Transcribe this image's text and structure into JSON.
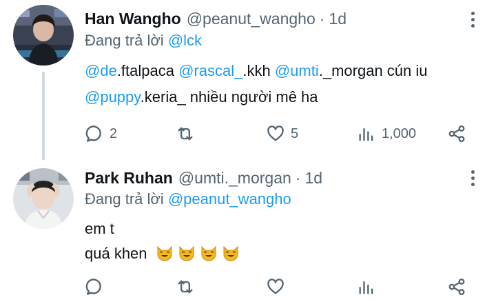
{
  "tweets": [
    {
      "display_name": "Han Wangho",
      "handle": "@peanut_wangho",
      "separator": "·",
      "time": "1d",
      "reply_prefix": "Đang trả lời",
      "reply_handle": "@lck",
      "line1": [
        {
          "text": "@de",
          "mention": true
        },
        {
          "text": ".ftalpaca ",
          "mention": false
        },
        {
          "text": "@rascal_",
          "mention": true
        },
        {
          "text": ".kkh ",
          "mention": false
        },
        {
          "text": "@umti",
          "mention": true
        },
        {
          "text": "._morgan cún iu",
          "mention": false
        }
      ],
      "line2": [
        {
          "text": "@puppy",
          "mention": true
        },
        {
          "text": ".keria_ nhiều người mê ha",
          "mention": false
        }
      ],
      "replies": "2",
      "retweets": "",
      "likes": "5",
      "views": "1,000"
    },
    {
      "display_name": "Park Ruhan",
      "handle": "@umti._morgan",
      "separator": "·",
      "time": "1d",
      "reply_prefix": "Đang trả lời",
      "reply_handle": "@peanut_wangho",
      "line1": [
        {
          "text": "em t",
          "mention": false
        }
      ],
      "line2": [
        {
          "text": "quá khen",
          "mention": false
        }
      ],
      "emoji": [
        "smiling-cat-emoji",
        "smiling-cat-emoji",
        "smiling-cat-emoji",
        "smiling-cat-emoji"
      ],
      "replies": "",
      "retweets": "",
      "likes": "",
      "views": ""
    }
  ],
  "icons": {
    "reply": "reply-bubble-icon",
    "retweet": "retweet-icon",
    "like": "heart-icon",
    "views": "views-bars-icon",
    "share": "share-icon",
    "more": "more-dots-icon"
  },
  "colors": {
    "mention": "#1d9bf0",
    "secondary_text": "#536471",
    "primary_text": "#0f1419",
    "thread_line": "#cfd9de"
  }
}
